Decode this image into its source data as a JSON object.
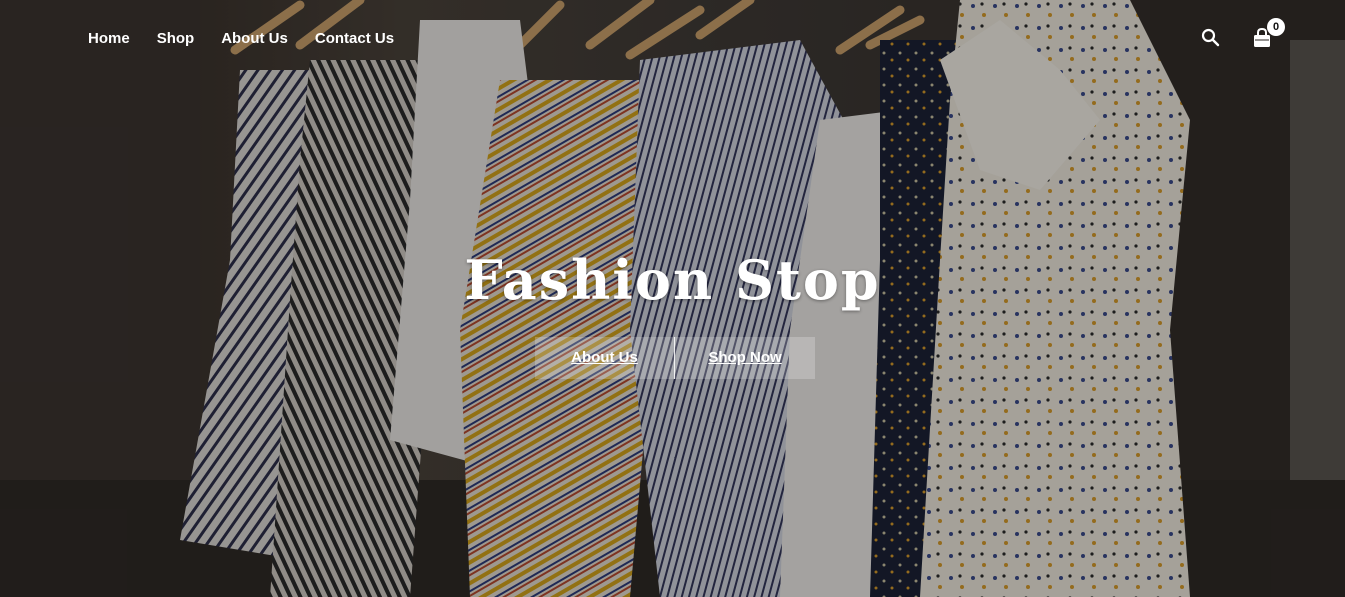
{
  "nav": {
    "items": [
      {
        "label": "Home"
      },
      {
        "label": "Shop"
      },
      {
        "label": "About Us"
      },
      {
        "label": "Contact Us"
      }
    ]
  },
  "header_icons": {
    "search_icon": "search-icon",
    "cart_icon": "shopping-bag-icon",
    "cart_count": "0"
  },
  "hero": {
    "title": "Fashion Stop",
    "background": "clothing-rack-photo",
    "buttons": [
      {
        "label": "About Us"
      },
      {
        "label": "Shop Now"
      }
    ]
  },
  "colors": {
    "text": "#ffffff",
    "overlay": "#000000",
    "button_bg": "rgba(255,255,255,0.22)"
  }
}
